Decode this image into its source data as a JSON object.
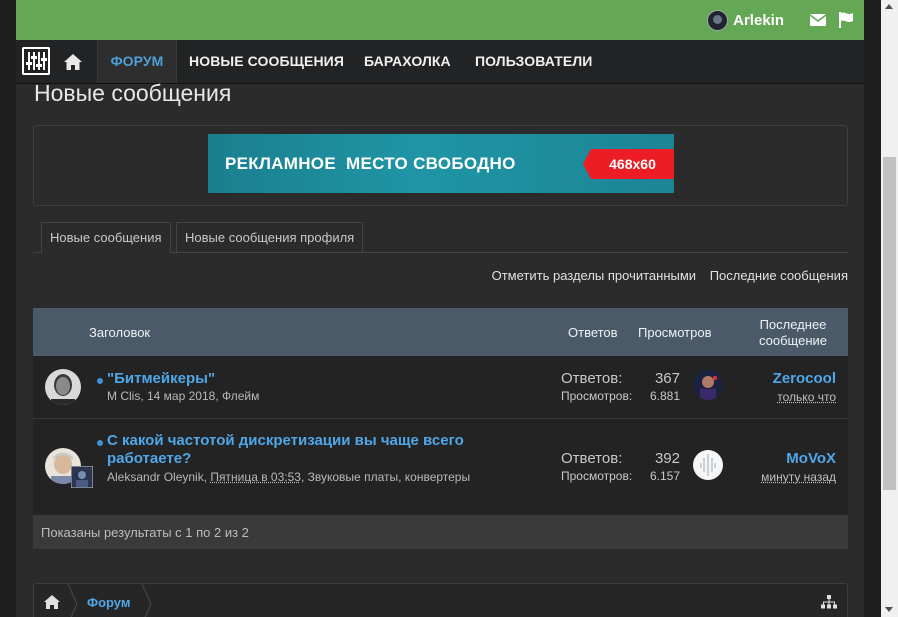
{
  "header": {
    "username": "Arlekin",
    "icons": [
      "avatar-icon",
      "envelope-icon",
      "flag-icon"
    ]
  },
  "nav": {
    "logo_icon": "equalizer-logo-icon",
    "home_icon": "home-icon",
    "items": [
      {
        "label": "ФОРУМ",
        "active": true
      },
      {
        "label": "НОВЫЕ СООБЩЕНИЯ",
        "active": false
      },
      {
        "label": "БАРАХОЛКА",
        "active": false
      },
      {
        "label": "ПОЛЬЗОВАТЕЛИ",
        "active": false
      }
    ]
  },
  "page": {
    "title": "Новые сообщения"
  },
  "ad": {
    "text": "РЕКЛАМНОЕ  МЕСТО СВОБОДНО",
    "size": "468x60"
  },
  "tabs": [
    {
      "label": "Новые сообщения",
      "active": true
    },
    {
      "label": "Новые сообщения профиля",
      "active": false
    }
  ],
  "links": {
    "mark_read": "Отметить разделы прочитанными",
    "latest": "Последние сообщения"
  },
  "table": {
    "headers": {
      "title": "Заголовок",
      "replies": "Ответов",
      "views": "Просмотров",
      "last_post": "Последнее сообщение"
    },
    "rows": [
      {
        "title": "\"Битмейкеры\"",
        "author": "M Clis",
        "date": "14 мар 2018",
        "forum": "Флейм",
        "replies_label": "Ответов:",
        "replies": "367",
        "views_label": "Просмотров:",
        "views": "6.881",
        "last_user": "Zerocool",
        "last_time": "только что"
      },
      {
        "title": "С какой частотой дискретизации вы чаще всего работаете?",
        "author": "Aleksandr Oleynik",
        "date": "Пятница в 03:53",
        "forum": "Звуковые платы, конвертеры",
        "replies_label": "Ответов:",
        "replies": "392",
        "views_label": "Просмотров:",
        "views": "6.157",
        "last_user": "MoVoX",
        "last_time": "минуту назад"
      }
    ],
    "footer": "Показаны результаты с 1 по 2 из 2"
  },
  "breadcrumb": {
    "home_icon": "home-icon",
    "items": [
      "Форум"
    ],
    "tree_icon": "sitemap-icon"
  },
  "colors": {
    "topbar": "#64a755",
    "accent": "#4fa7e8",
    "table_header": "#4b5a68"
  }
}
